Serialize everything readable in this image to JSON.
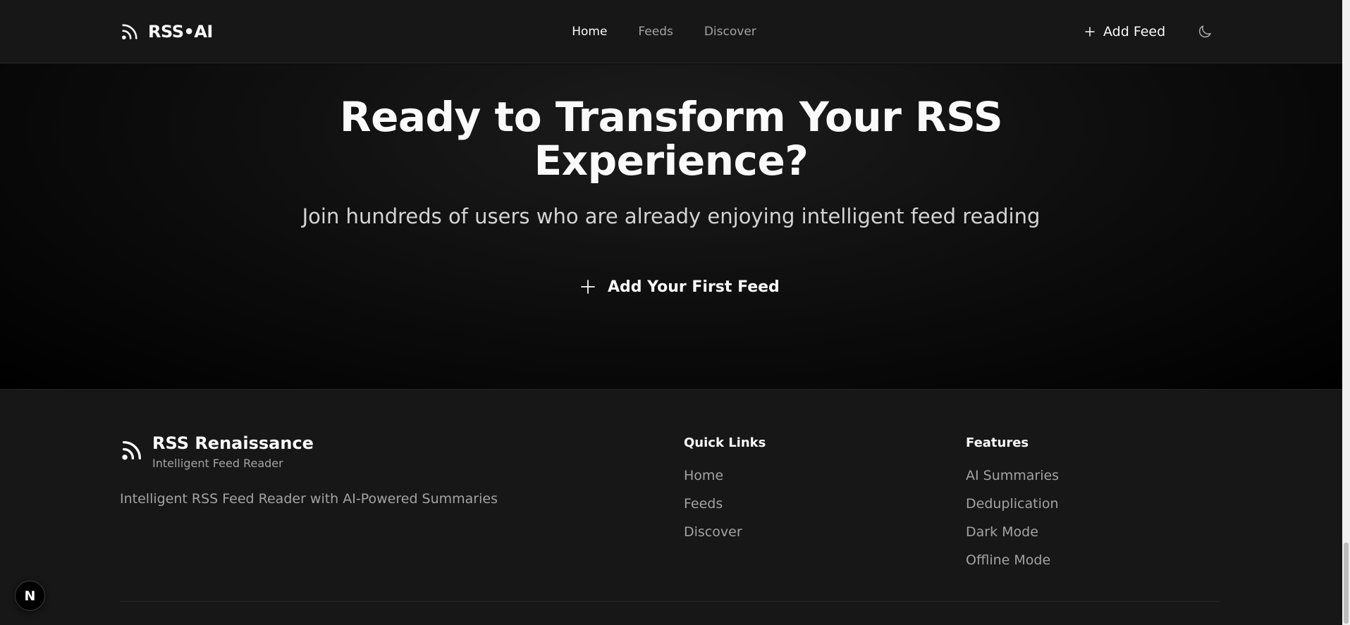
{
  "header": {
    "logo_text": "RSS•AI",
    "nav": [
      {
        "label": "Home",
        "active": true
      },
      {
        "label": "Feeds",
        "active": false
      },
      {
        "label": "Discover",
        "active": false
      }
    ],
    "add_feed_label": "Add Feed",
    "theme_icon": "moon-icon"
  },
  "cta": {
    "title": "Ready to Transform Your RSS Experience?",
    "subtitle": "Join hundreds of users who are already enjoying intelligent feed reading",
    "button_label": "Add Your First Feed"
  },
  "footer": {
    "brand_name": "RSS Renaissance",
    "brand_tagline": "Intelligent Feed Reader",
    "description": "Intelligent RSS Feed Reader with AI-Powered Summaries",
    "quick_links": {
      "heading": "Quick Links",
      "items": [
        "Home",
        "Feeds",
        "Discover"
      ]
    },
    "features": {
      "heading": "Features",
      "items": [
        "AI Summaries",
        "Deduplication",
        "Dark Mode",
        "Offline Mode"
      ]
    }
  },
  "dev_badge": {
    "label": "N"
  },
  "colors": {
    "background": "#0a0a0a",
    "surface": "#171717",
    "text": "#fafafa",
    "muted": "#a3a3a3"
  }
}
